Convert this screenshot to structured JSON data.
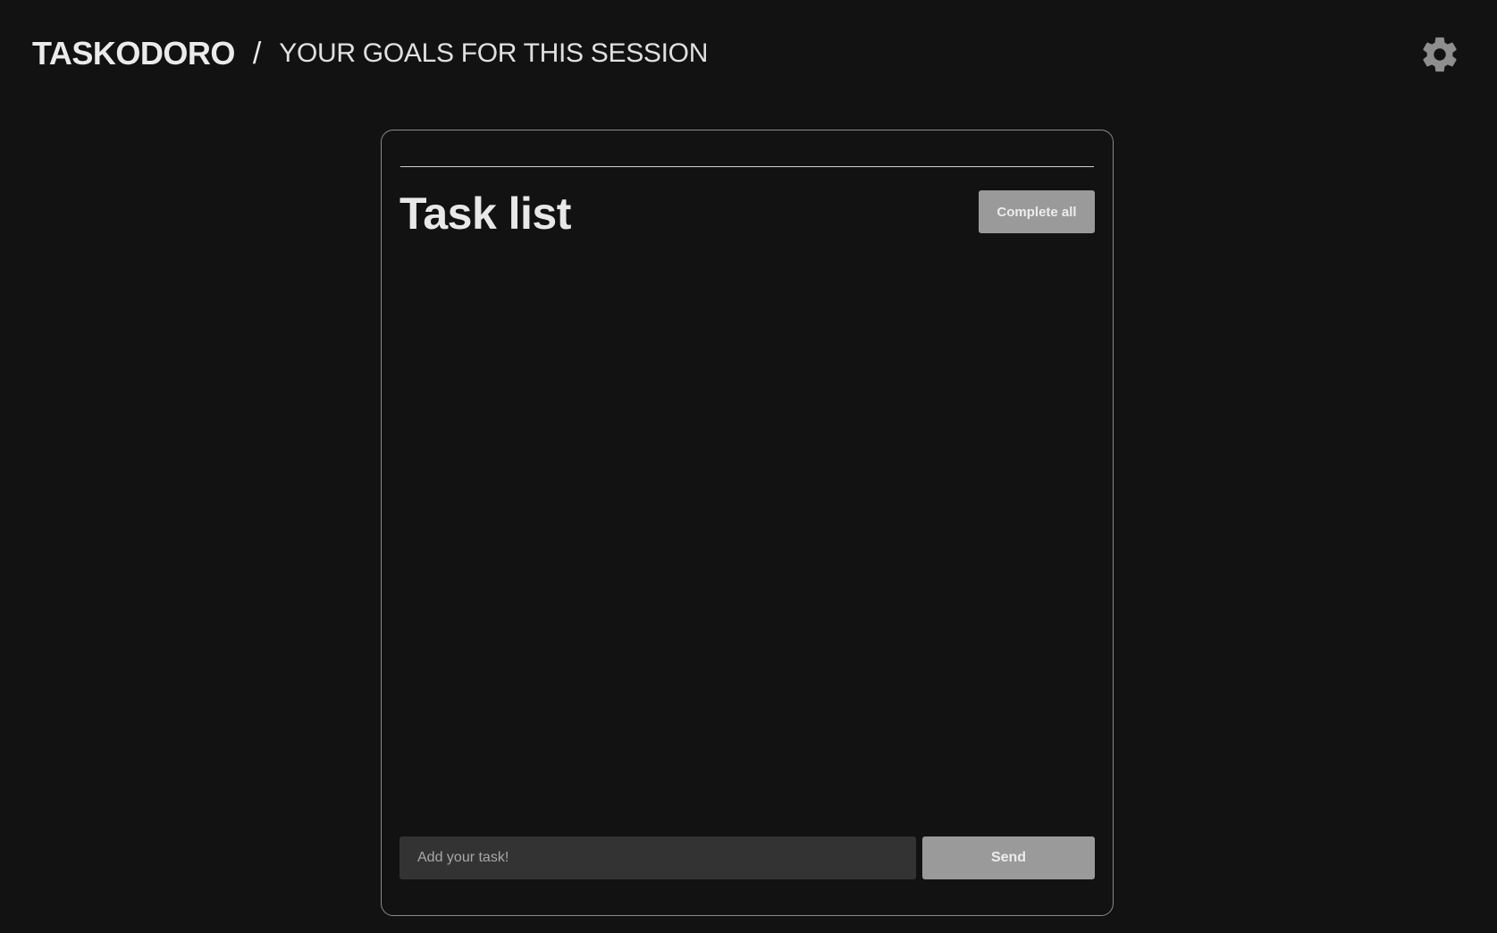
{
  "header": {
    "brand": "TASKODORO",
    "separator": "/",
    "subtitle": "YOUR GOALS FOR THIS SESSION",
    "settings_icon": "gear-icon"
  },
  "card": {
    "title": "Task list",
    "complete_all_label": "Complete all",
    "tasks": [],
    "input_value": "",
    "input_placeholder": "Add your task!",
    "send_label": "Send"
  },
  "colors": {
    "background": "#121212",
    "button": "#9a9a9a",
    "input": "#333333",
    "border": "#8a8a8a"
  }
}
